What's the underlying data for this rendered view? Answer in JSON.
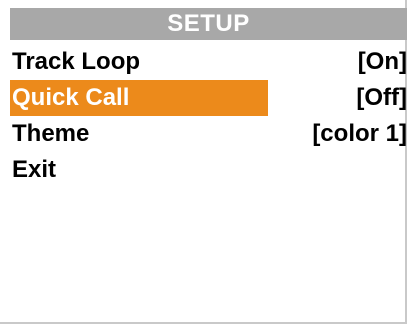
{
  "screen": {
    "title": "SETUP",
    "colors": {
      "title_bar": "#a8a8a8",
      "selected_highlight": "#ec8a1b",
      "text": "#000000",
      "background": "#ffffff"
    }
  },
  "menu": {
    "items": [
      {
        "label": "Track Loop",
        "value": "[On]",
        "selected": false
      },
      {
        "label": "Quick Call",
        "value": "[Off]",
        "selected": true
      },
      {
        "label": "Theme",
        "value": "[color 1]",
        "selected": false
      },
      {
        "label": "Exit",
        "value": "",
        "selected": false
      }
    ]
  }
}
